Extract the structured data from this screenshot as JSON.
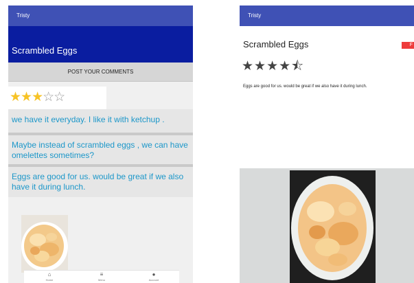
{
  "left": {
    "appbar_title": "Tristy",
    "dish_title": "Scrambled Eggs",
    "post_button": "POST YOUR COMMENTS",
    "rating": {
      "value": 2.5,
      "max": 5,
      "full": "★★",
      "half": "★",
      "empty": "☆☆"
    },
    "comments": [
      "we have it everyday. I like it with ketchup .",
      "Maybe instead of scrambled eggs , we can have omelettes sometimes?",
      "Eggs are good for us. would be great if we also have it during lunch."
    ],
    "nav": [
      {
        "icon": "home-icon",
        "glyph": "⌂",
        "label": "Home"
      },
      {
        "icon": "menu-icon",
        "glyph": "≡",
        "label": "Menu"
      },
      {
        "icon": "account-icon",
        "glyph": "●",
        "label": "Account"
      }
    ]
  },
  "right": {
    "appbar_title": "Tristy",
    "dish_title": "Scrambled Eggs",
    "badge": "F",
    "rating": {
      "value": 4.5,
      "max": 5,
      "glyphs": "★★★★⯪"
    },
    "description": "Eggs are good for us. would be great if we also have it during lunch."
  },
  "colors": {
    "appbar": "#3f51b5",
    "header": "#0a1da0",
    "comment_text": "#1c97c9",
    "star": "#f7c326",
    "badge": "#ee3b3b"
  }
}
